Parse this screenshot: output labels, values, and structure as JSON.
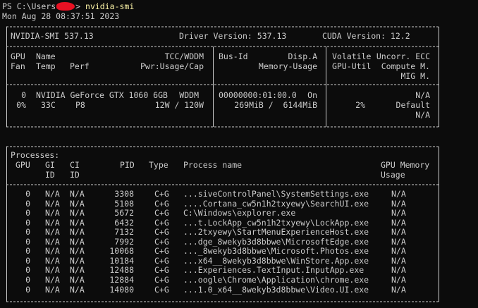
{
  "prompt": {
    "prefix": "PS C:\\Users",
    "suffix": "> ",
    "command": "nvidia-smi"
  },
  "timestamp": "Mon Aug 28 08:37:51 2023",
  "table_border_top": "+---------------------------------------------------------------------------------------+",
  "summary": {
    "smi_version": "NVIDIA-SMI 537.13",
    "driver_version": "Driver Version: 537.13",
    "cuda_version": "CUDA Version: 12.2"
  },
  "headers": {
    "gpu": "GPU",
    "name": "Name",
    "tcc_wddm": "TCC/WDDM",
    "bus_id": "Bus-Id",
    "disp_a": "Disp.A",
    "volatile": "Volatile",
    "uncorr_ecc": "Uncorr. ECC",
    "fan": "Fan",
    "temp": "Temp",
    "perf": "Perf",
    "pwr": "Pwr:Usage/Cap",
    "memory_usage": "Memory-Usage",
    "gpu_util": "GPU-Util",
    "compute_m": "Compute M.",
    "mig_m": "MIG M."
  },
  "gpu": {
    "index": "0",
    "name": "NVIDIA GeForce GTX 1060 6GB",
    "mode": "WDDM",
    "bus_id": "00000000:01:00.0",
    "disp_a": "On",
    "ecc": "N/A",
    "fan": "0%",
    "temp": "33C",
    "perf": "P8",
    "power": "12W / 120W",
    "memory": "269MiB /  6144MiB",
    "util": "2%",
    "compute_mode": "Default",
    "mig_mode": "N/A"
  },
  "processes_header": {
    "title": "Processes:",
    "gpu": "GPU",
    "gi": "GI",
    "ci": "CI",
    "pid": "PID",
    "type": "Type",
    "name": "Process name",
    "gpu_memory": "GPU Memory",
    "gi_id": "ID",
    "ci_id": "ID",
    "usage": "Usage"
  },
  "processes": [
    {
      "gpu": "0",
      "gi": "N/A",
      "ci": "N/A",
      "pid": "3308",
      "type": "C+G",
      "name": "...siveControlPanel\\SystemSettings.exe",
      "mem": "N/A"
    },
    {
      "gpu": "0",
      "gi": "N/A",
      "ci": "N/A",
      "pid": "5108",
      "type": "C+G",
      "name": "....Cortana_cw5n1h2txyewy\\SearchUI.exe",
      "mem": "N/A"
    },
    {
      "gpu": "0",
      "gi": "N/A",
      "ci": "N/A",
      "pid": "5672",
      "type": "C+G",
      "name": "C:\\Windows\\explorer.exe",
      "mem": "N/A"
    },
    {
      "gpu": "0",
      "gi": "N/A",
      "ci": "N/A",
      "pid": "6432",
      "type": "C+G",
      "name": "...t.LockApp_cw5n1h2txyewy\\LockApp.exe",
      "mem": "N/A"
    },
    {
      "gpu": "0",
      "gi": "N/A",
      "ci": "N/A",
      "pid": "7132",
      "type": "C+G",
      "name": "...2txyewy\\StartMenuExperienceHost.exe",
      "mem": "N/A"
    },
    {
      "gpu": "0",
      "gi": "N/A",
      "ci": "N/A",
      "pid": "7992",
      "type": "C+G",
      "name": "...dge_8wekyb3d8bbwe\\MicrosoftEdge.exe",
      "mem": "N/A"
    },
    {
      "gpu": "0",
      "gi": "N/A",
      "ci": "N/A",
      "pid": "10068",
      "type": "C+G",
      "name": "..._8wekyb3d8bbwe\\Microsoft.Photos.exe",
      "mem": "N/A"
    },
    {
      "gpu": "0",
      "gi": "N/A",
      "ci": "N/A",
      "pid": "10184",
      "type": "C+G",
      "name": "...x64__8wekyb3d8bbwe\\WinStore.App.exe",
      "mem": "N/A"
    },
    {
      "gpu": "0",
      "gi": "N/A",
      "ci": "N/A",
      "pid": "12488",
      "type": "C+G",
      "name": "...Experiences.TextInput.InputApp.exe",
      "mem": "N/A"
    },
    {
      "gpu": "0",
      "gi": "N/A",
      "ci": "N/A",
      "pid": "12884",
      "type": "C+G",
      "name": "...oogle\\Chrome\\Application\\chrome.exe",
      "mem": "N/A"
    },
    {
      "gpu": "0",
      "gi": "N/A",
      "ci": "N/A",
      "pid": "14080",
      "type": "C+G",
      "name": "...1.0_x64__8wekyb3d8bbwe\\Video.UI.exe",
      "mem": "N/A"
    }
  ]
}
